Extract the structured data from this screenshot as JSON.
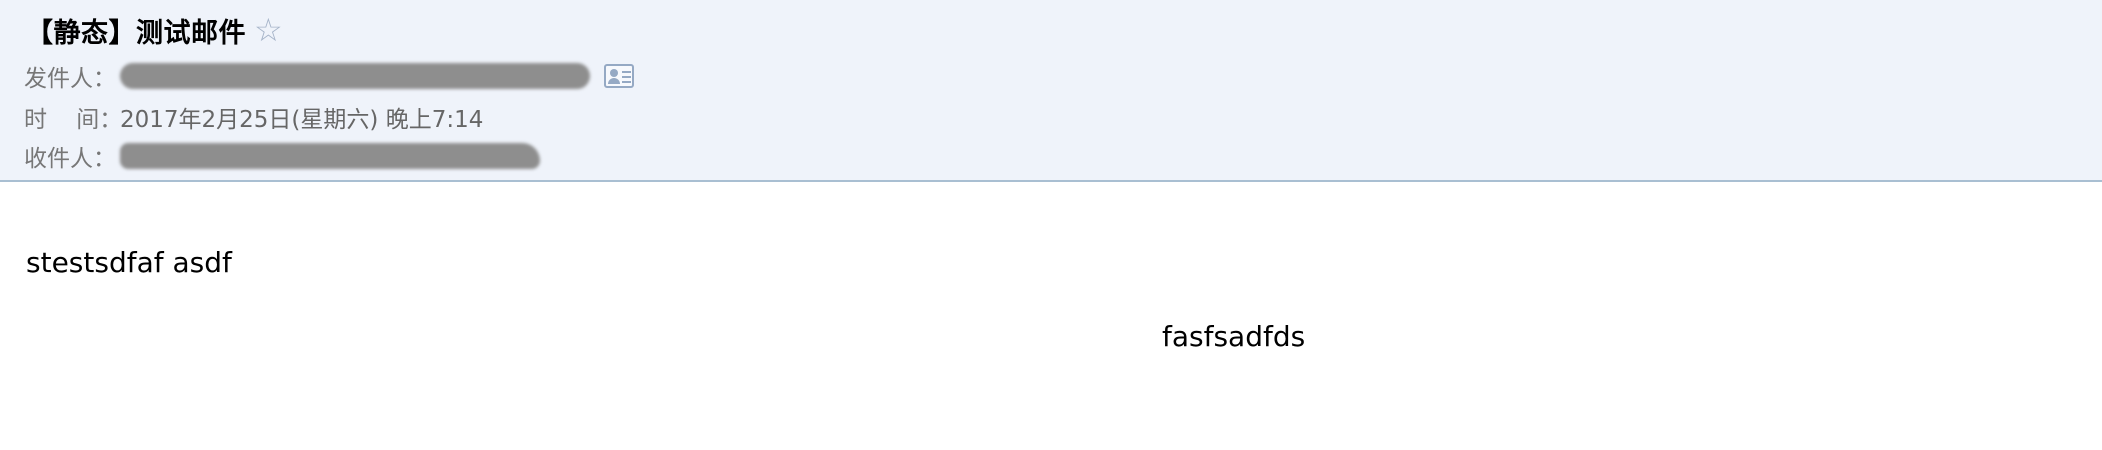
{
  "header": {
    "subject": "【静态】测试邮件",
    "star_icon": "☆",
    "sender": {
      "label": "发件人：",
      "value_redacted": true
    },
    "time": {
      "label": "时    间：",
      "value": "2017年2月25日(星期六) 晚上7:14"
    },
    "recipient": {
      "label": "收件人：",
      "value_redacted": true
    }
  },
  "body": {
    "line1": "stestsdfaf asdf",
    "line2": "fasfsadfds"
  },
  "colors": {
    "header_bg": "#eff3fa",
    "header_border": "#a9bfd2",
    "label_text": "#777777",
    "icon_accent": "#95a9c4"
  }
}
